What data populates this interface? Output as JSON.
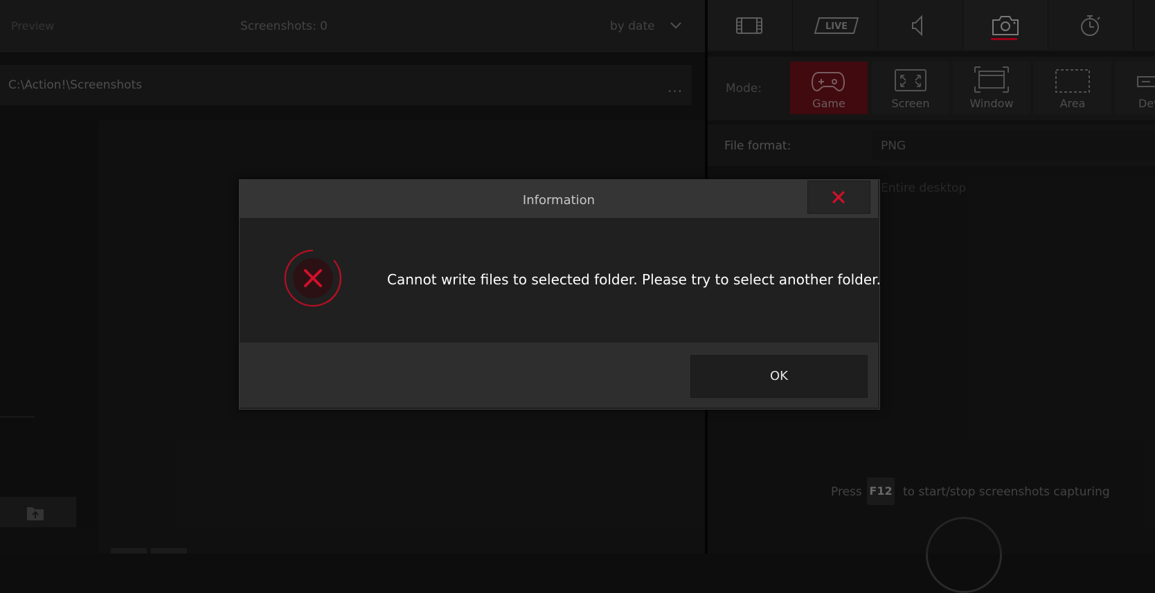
{
  "left_panel": {
    "header_label": "Preview",
    "screenshots_count": "Screenshots: 0",
    "sort_label": "by date",
    "path": "C:\\Action!\\Screenshots",
    "path_more": "..."
  },
  "right_panel": {
    "tabs": [
      {
        "name": "video-tab",
        "icon": "film-icon"
      },
      {
        "name": "live-tab",
        "icon": "live-icon",
        "text": "LIVE"
      },
      {
        "name": "audio-tab",
        "icon": "speaker-icon"
      },
      {
        "name": "screenshot-tab",
        "icon": "camera-icon",
        "active": true
      },
      {
        "name": "benchmark-tab",
        "icon": "stopwatch-icon"
      }
    ],
    "mode_label": "Mode:",
    "modes": [
      {
        "label": "Game",
        "icon": "gamepad-icon",
        "selected": true
      },
      {
        "label": "Screen",
        "icon": "fullscreen-icon"
      },
      {
        "label": "Window",
        "icon": "window-icon"
      },
      {
        "label": "Area",
        "icon": "area-icon"
      },
      {
        "label": "Dev",
        "icon": "device-icon"
      }
    ],
    "file_format_label": "File format:",
    "file_format_value": "PNG",
    "region_value": "Entire desktop",
    "hint_press": "Press",
    "hint_key": "F12",
    "hint_text": "to start/stop screenshots capturing"
  },
  "dialog": {
    "title": "Information",
    "message": "Cannot write files to selected folder. Please try to select another folder.",
    "ok_label": "OK",
    "icon": "error-icon"
  },
  "colors": {
    "accent_red": "#c8102e",
    "dialog_bg": "#202020",
    "dialog_header": "#353535"
  }
}
